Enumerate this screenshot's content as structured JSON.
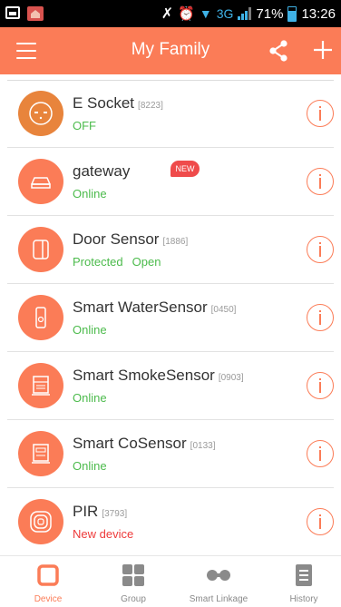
{
  "status_bar": {
    "battery": "71%",
    "network": "3G",
    "time": "13:26"
  },
  "header": {
    "title": "My Family"
  },
  "devices": [
    {
      "name": "E Socket",
      "code": "[8223]",
      "status": [
        "OFF"
      ],
      "icon": "socket-icon"
    },
    {
      "name": "gateway",
      "code": "",
      "status": [
        "Online"
      ],
      "badge": "NEW",
      "icon": "gateway-icon"
    },
    {
      "name": "Door Sensor",
      "code": "[1886]",
      "status": [
        "Protected",
        "Open"
      ],
      "icon": "door-sensor-icon"
    },
    {
      "name": "Smart WaterSensor",
      "code": "[0450]",
      "status": [
        "Online"
      ],
      "icon": "water-sensor-icon"
    },
    {
      "name": "Smart SmokeSensor",
      "code": "[0903]",
      "status": [
        "Online"
      ],
      "icon": "smoke-sensor-icon"
    },
    {
      "name": "Smart CoSensor",
      "code": "[0133]",
      "status": [
        "Online"
      ],
      "icon": "co-sensor-icon"
    },
    {
      "name": "PIR",
      "code": "[3793]",
      "status": [
        "New device"
      ],
      "icon": "pir-icon"
    }
  ],
  "tabs": [
    {
      "label": "Device",
      "active": true
    },
    {
      "label": "Group",
      "active": false
    },
    {
      "label": "Smart Linkage",
      "active": false
    },
    {
      "label": "History",
      "active": false
    }
  ],
  "colors": {
    "accent": "#fb7c57",
    "socket": "#e8843c",
    "online": "#4cbb4c",
    "new_device": "#ee3a3a",
    "badge": "#ef4b4b"
  }
}
